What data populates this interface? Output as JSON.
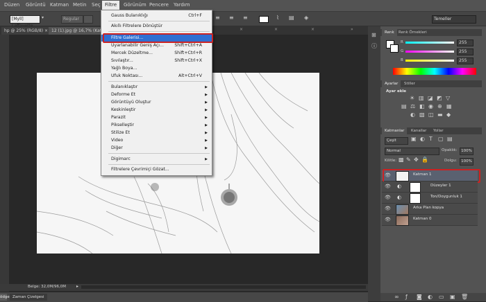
{
  "menu": {
    "items": [
      "Düzen",
      "Görüntü",
      "Katman",
      "Metin",
      "Seç",
      "Filtre",
      "Görünüm",
      "Pencere",
      "Yardım"
    ]
  },
  "options": {
    "font": "[Myll] Laffayette...",
    "style": "Regular",
    "workspace": "Temeller"
  },
  "tabs": [
    {
      "label": "hp @ 25% (RGB/8) ×"
    },
    {
      "label": "12 (1).jpg @ 16,7% (Kat"
    }
  ],
  "filter_menu": {
    "items": [
      {
        "label": "Gauss Bulanıklığı",
        "shortcut": "Ctrl+F"
      },
      {
        "label": "Akıllı Filtrelere Dönüştür",
        "shortcut": ""
      },
      {
        "label": "Filtre Galerisi...",
        "shortcut": ""
      },
      {
        "label": "Uyarlanabilir Geniş Açı...",
        "shortcut": "Shift+Ctrl+A"
      },
      {
        "label": "Mercek Düzeltme...",
        "shortcut": "Shift+Ctrl+R"
      },
      {
        "label": "Sıvılaştır...",
        "shortcut": "Shift+Ctrl+X"
      },
      {
        "label": "Yağlı Boya...",
        "shortcut": ""
      },
      {
        "label": "Ufuk Noktası...",
        "shortcut": "Alt+Ctrl+V"
      },
      {
        "label": "Bulanıklaştır",
        "shortcut": ""
      },
      {
        "label": "Deforme Et",
        "shortcut": ""
      },
      {
        "label": "Görüntüyü Oluştur",
        "shortcut": ""
      },
      {
        "label": "Keskinleştir",
        "shortcut": ""
      },
      {
        "label": "Parazit",
        "shortcut": ""
      },
      {
        "label": "Pikselleştir",
        "shortcut": ""
      },
      {
        "label": "Stilize Et",
        "shortcut": ""
      },
      {
        "label": "Video",
        "shortcut": ""
      },
      {
        "label": "Diğer",
        "shortcut": ""
      },
      {
        "label": "Digimarc",
        "shortcut": ""
      },
      {
        "label": "Filtrelere Çevrimiçi Gözat...",
        "shortcut": ""
      }
    ]
  },
  "color_panel": {
    "tabs": [
      "Renk",
      "Renk Örnekleri"
    ],
    "r": "255",
    "g": "255",
    "b": "255"
  },
  "adjust_panel": {
    "tabs": [
      "Ayarlar",
      "Stiller"
    ],
    "heading": "Ayar ekle"
  },
  "layers_panel": {
    "tabs": [
      "Katmanlar",
      "Kanallar",
      "Yollar"
    ],
    "kind": "Çeşit",
    "blend": "Normal",
    "opacity_label": "Opaklık:",
    "opacity": "100%",
    "lock_label": "Kilitle:",
    "fill_label": "Dolgu:",
    "fill": "100%",
    "layers": [
      {
        "name": "Katman 1"
      },
      {
        "name": "Düzeyler 1"
      },
      {
        "name": "Ton/Doygunluk 1"
      },
      {
        "name": "Arka Plan kopya"
      },
      {
        "name": "Katman 0"
      }
    ]
  },
  "status": {
    "doc": "Belge: 32,0M/96,0M"
  },
  "timeline": {
    "left": "ödge",
    "label": "Zaman Çizelgesi"
  },
  "colors": {
    "highlight": "#2f6fd2",
    "annotation": "#cc2222"
  }
}
